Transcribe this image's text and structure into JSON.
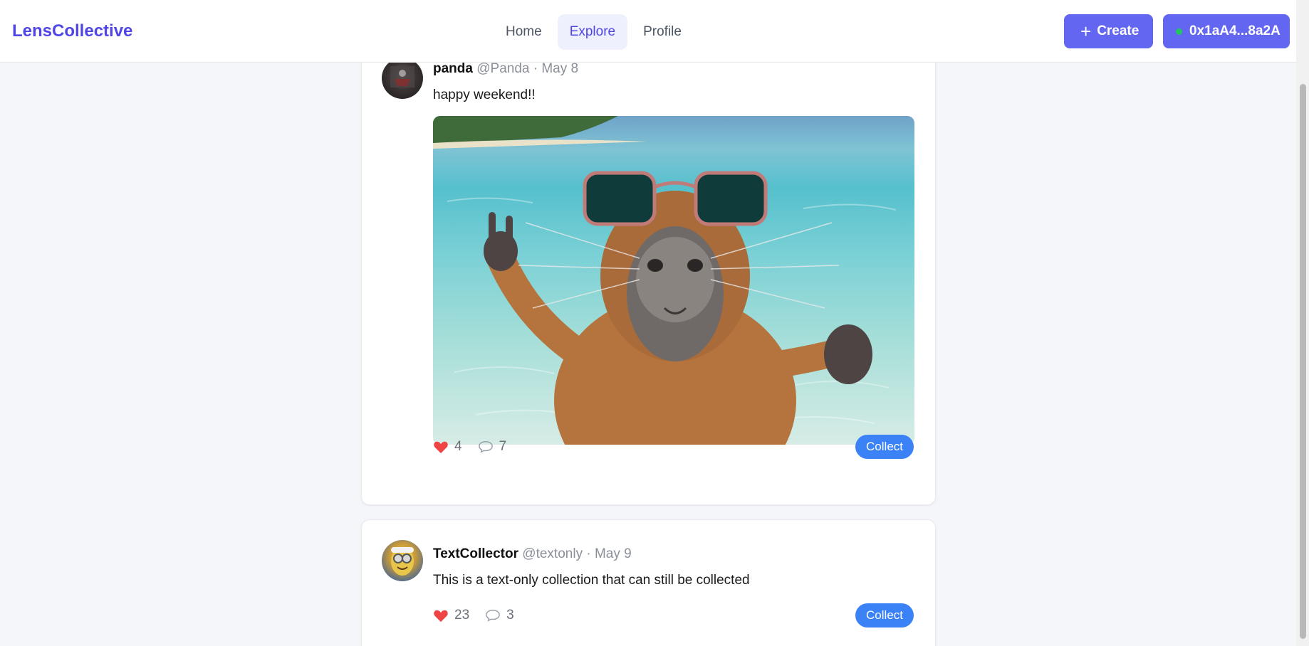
{
  "app": {
    "logo": "LensCollective"
  },
  "nav": [
    {
      "label": "Home",
      "active": false
    },
    {
      "label": "Explore",
      "active": true
    },
    {
      "label": "Profile",
      "active": false
    }
  ],
  "header": {
    "create_icon": "plus-icon",
    "create_label": "Create",
    "wallet_status_color": "#22c55e",
    "wallet_address": "0x1aA4...8a2A"
  },
  "posts": [
    {
      "name": "panda",
      "handle": "@Panda",
      "separator": "·",
      "date": "May 8",
      "text": "happy weekend!!",
      "image": "capybara-wearing-sunglasses-in-sea",
      "likes": "4",
      "comments": "7",
      "collect_label": "Collect"
    },
    {
      "name": "TextCollector",
      "handle": "@textonly",
      "separator": "·",
      "date": "May 9",
      "text": "This is a text-only collection that can still be collected",
      "likes": "23",
      "comments": "3",
      "collect_label": "Collect"
    }
  ],
  "colors": {
    "brand": "#4f46e5",
    "primary_button": "#6366f1",
    "collect_button": "#3b82f6",
    "heart": "#ef4444"
  }
}
